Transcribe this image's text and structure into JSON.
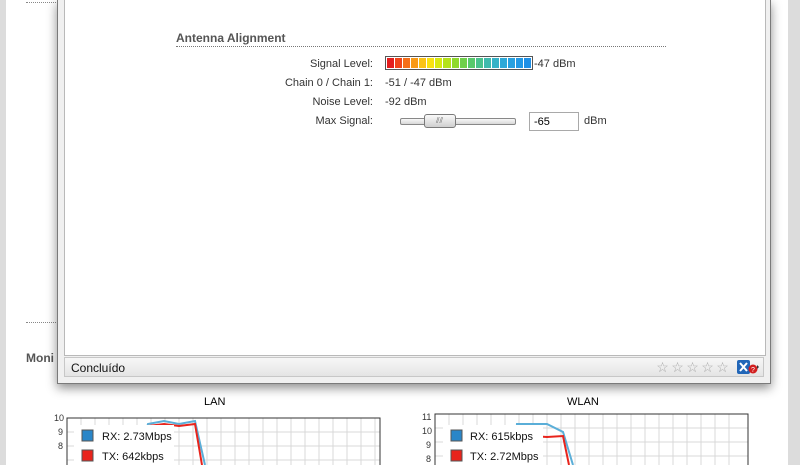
{
  "background": {
    "monitor_label": "Moni",
    "charts": [
      {
        "title": "LAN",
        "y_ticks": [
          "10",
          "9",
          "8"
        ],
        "legend": [
          {
            "label": "RX: 2.73Mbps",
            "color": "#2a86c8"
          },
          {
            "label": "TX: 642kbps",
            "color": "#e8241c"
          }
        ]
      },
      {
        "title": "WLAN",
        "y_ticks": [
          "11",
          "10",
          "9",
          "8"
        ],
        "legend": [
          {
            "label": "RX: 615kbps",
            "color": "#2a86c8"
          },
          {
            "label": "TX: 2.72Mbps",
            "color": "#e8241c"
          }
        ]
      }
    ]
  },
  "popup": {
    "section_title": "Antenna Alignment",
    "signal_level": {
      "label": "Signal Level:",
      "value": "-47 dBm",
      "level_fraction": 1.0
    },
    "chain": {
      "label": "Chain 0 / Chain 1:",
      "value": "-51 / -47 dBm"
    },
    "noise": {
      "label": "Noise Level:",
      "value": "-92 dBm"
    },
    "max_signal": {
      "label": "Max Signal:",
      "input_value": "-65",
      "unit": "dBm",
      "slider_fraction": 0.28
    }
  },
  "status_bar": {
    "text": "Concluído",
    "rating_stars": 5
  },
  "colors": {
    "meter": [
      "#e41d1d",
      "#f0441a",
      "#f56f19",
      "#f99a17",
      "#fbc316",
      "#f9e20f",
      "#d8e90f",
      "#b4e21a",
      "#8fd92c",
      "#6fd04a",
      "#58c96b",
      "#4ac28c",
      "#3fbaad",
      "#36b2c7",
      "#2ea9d8",
      "#28a0e0",
      "#2398e4",
      "#1f90e6"
    ]
  }
}
